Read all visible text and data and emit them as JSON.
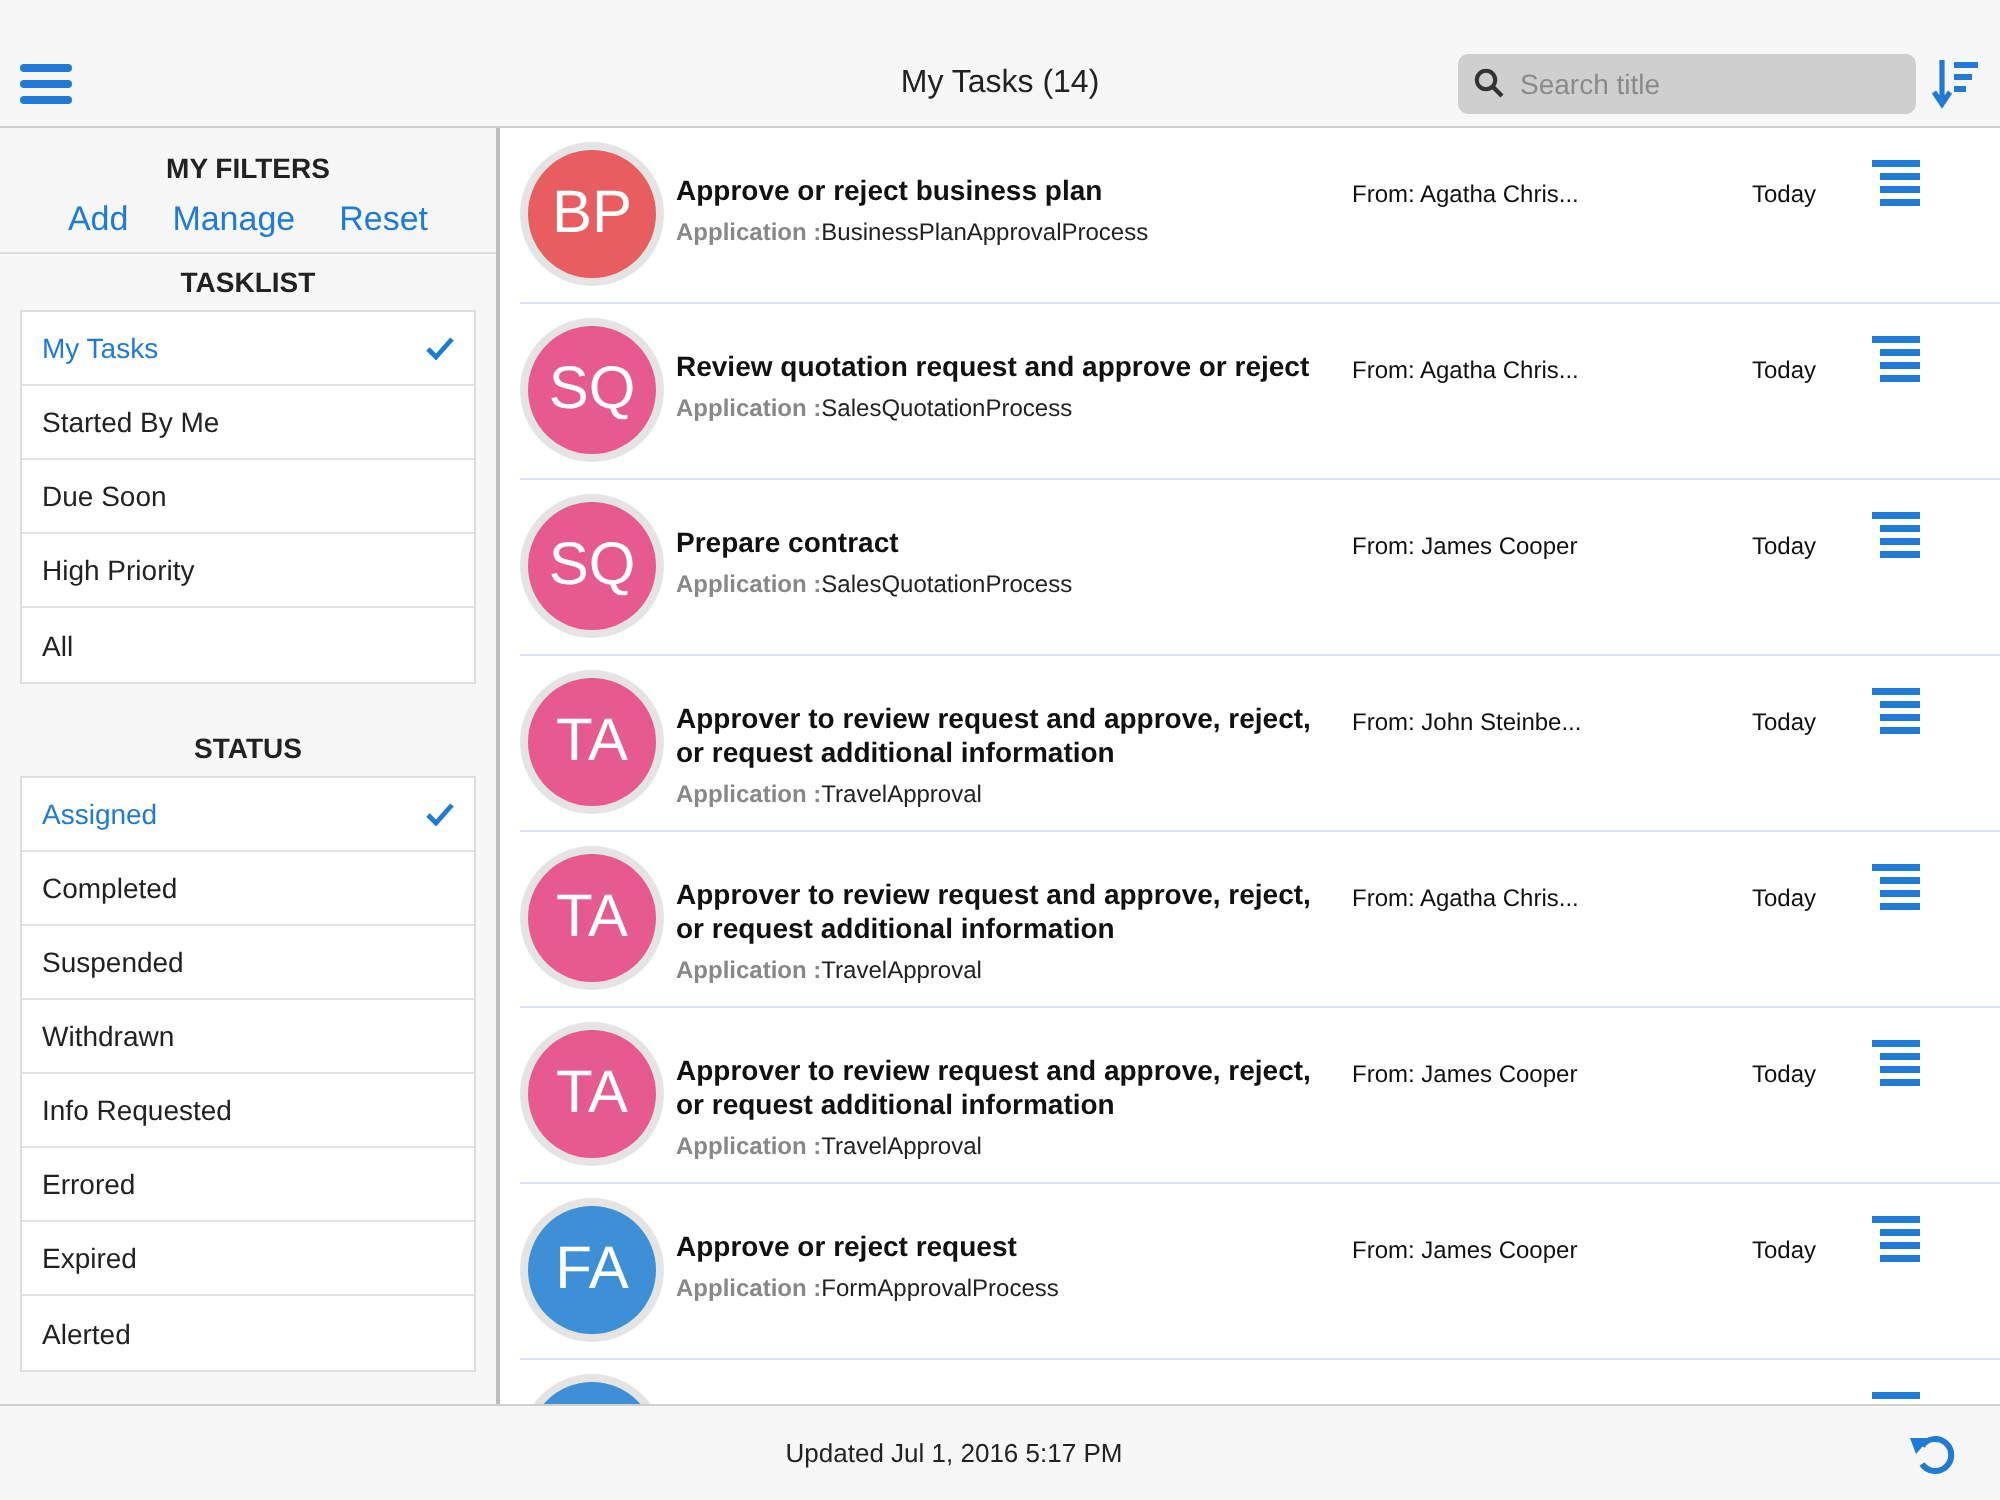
{
  "header": {
    "title": "My Tasks (14)",
    "search": {
      "placeholder": "Search title"
    }
  },
  "sidebar": {
    "title": "MY FILTERS",
    "actions": [
      "Add",
      "Manage",
      "Reset"
    ],
    "tasklist": {
      "title": "TASKLIST",
      "items": [
        {
          "label": "My Tasks",
          "selected": true
        },
        {
          "label": "Started By Me",
          "selected": false
        },
        {
          "label": "Due Soon",
          "selected": false
        },
        {
          "label": "High Priority",
          "selected": false
        },
        {
          "label": "All",
          "selected": false
        }
      ]
    },
    "status": {
      "title": "STATUS",
      "items": [
        {
          "label": "Assigned",
          "selected": true
        },
        {
          "label": "Completed",
          "selected": false
        },
        {
          "label": "Suspended",
          "selected": false
        },
        {
          "label": "Withdrawn",
          "selected": false
        },
        {
          "label": "Info Requested",
          "selected": false
        },
        {
          "label": "Errored",
          "selected": false
        },
        {
          "label": "Expired",
          "selected": false
        },
        {
          "label": "Alerted",
          "selected": false
        }
      ]
    }
  },
  "tasks": [
    {
      "kind": "full",
      "initials": "BP",
      "color": "#e85d5f",
      "title": "Approve or reject business plan",
      "app_label": "Application :",
      "app": "BusinessPlanApprovalProcess",
      "from": "From: Agatha Chris...",
      "date": "Today"
    },
    {
      "kind": "full",
      "initials": "SQ",
      "color": "#e65a90",
      "title": "Review quotation request and approve or reject",
      "app_label": "Application :",
      "app": "SalesQuotationProcess",
      "from": "From: Agatha Chris...",
      "date": "Today"
    },
    {
      "kind": "full",
      "initials": "SQ",
      "color": "#e65a90",
      "title": "Prepare contract",
      "app_label": "Application :",
      "app": "SalesQuotationProcess",
      "from": "From: James Cooper",
      "date": "Today"
    },
    {
      "kind": "full",
      "initials": "TA",
      "color": "#e65a90",
      "title": "Approver to review request and approve, reject, or request additional information",
      "app_label": "Application :",
      "app": "TravelApproval",
      "from": "From: John Steinbe...",
      "date": "Today"
    },
    {
      "kind": "full",
      "initials": "TA",
      "color": "#e65a90",
      "title": "Approver to review request and approve, reject, or request additional information",
      "app_label": "Application :",
      "app": "TravelApproval",
      "from": "From: Agatha Chris...",
      "date": "Today"
    },
    {
      "kind": "full",
      "initials": "TA",
      "color": "#e65a90",
      "title": "Approver to review request and approve, reject, or request additional information",
      "app_label": "Application :",
      "app": "TravelApproval",
      "from": "From: James Cooper",
      "date": "Today"
    },
    {
      "kind": "full",
      "initials": "FA",
      "color": "#3d8fd6",
      "title": "Approve or reject request",
      "app_label": "Application :",
      "app": "FormApprovalProcess",
      "from": "From: James Cooper",
      "date": "Today"
    },
    {
      "kind": "partial",
      "color": "#3d8fd6"
    }
  ],
  "footer": {
    "updated": "Updated Jul 1, 2016 5:17 PM"
  }
}
